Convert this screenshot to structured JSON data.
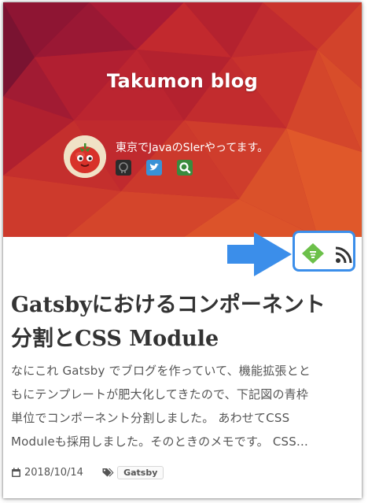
{
  "blog": {
    "title": "Takumon blog",
    "bio": "東京でJavaのSIerやってます。"
  },
  "social": [
    "github-icon",
    "twitter-icon",
    "search-icon"
  ],
  "subscribe": {
    "feedly_icon": "feedly-icon",
    "rss_icon": "rss-icon",
    "highlight_color": "#3b8eea"
  },
  "post": {
    "title_line1": "Gatsbyにおけるコンポーネント",
    "title_line2": "分割とCSS Module",
    "excerpt_lines": [
      "なにこれ Gatsby でブログを作っていて、機能拡張とと",
      "もにテンプレートが肥大化してきたので、下記図の青枠",
      "単位でコンポーネント分割しました。 あわせてCSS",
      "Moduleも採用しました。そのときのメモです。 CSS…"
    ],
    "date": "2018/10/14",
    "tag": "Gatsby"
  },
  "colors": {
    "hero": "#b81f2f",
    "feedly": "#6cc04a",
    "text": "#333333"
  }
}
